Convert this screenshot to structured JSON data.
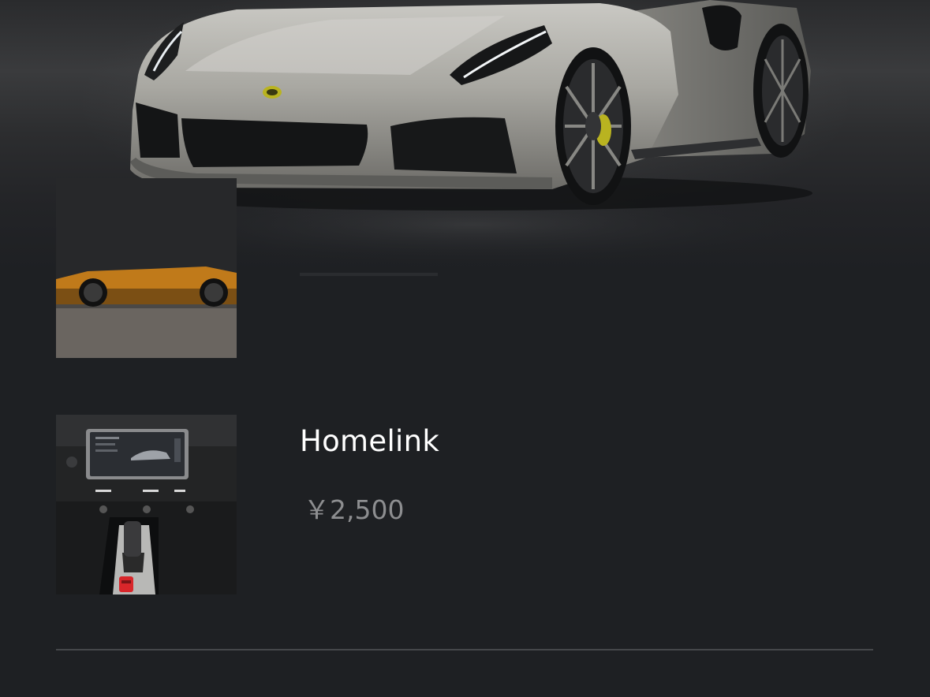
{
  "hero": {
    "image_icon": "car-front-image"
  },
  "options": [
    {
      "image_icon": "car-side-orange-image",
      "title": "",
      "price": ""
    },
    {
      "image_icon": "car-interior-console-image",
      "title": "Homelink",
      "price": "￥2,500"
    }
  ],
  "colors": {
    "background": "#1e2023",
    "title_text": "#ffffff",
    "price_text": "#8d8e90",
    "divider": "#45474a",
    "car_body": "#a8a7a1",
    "accent_orange": "#c07a1a",
    "caliper_yellow": "#b9b320",
    "red_start_button": "#d8262a"
  }
}
